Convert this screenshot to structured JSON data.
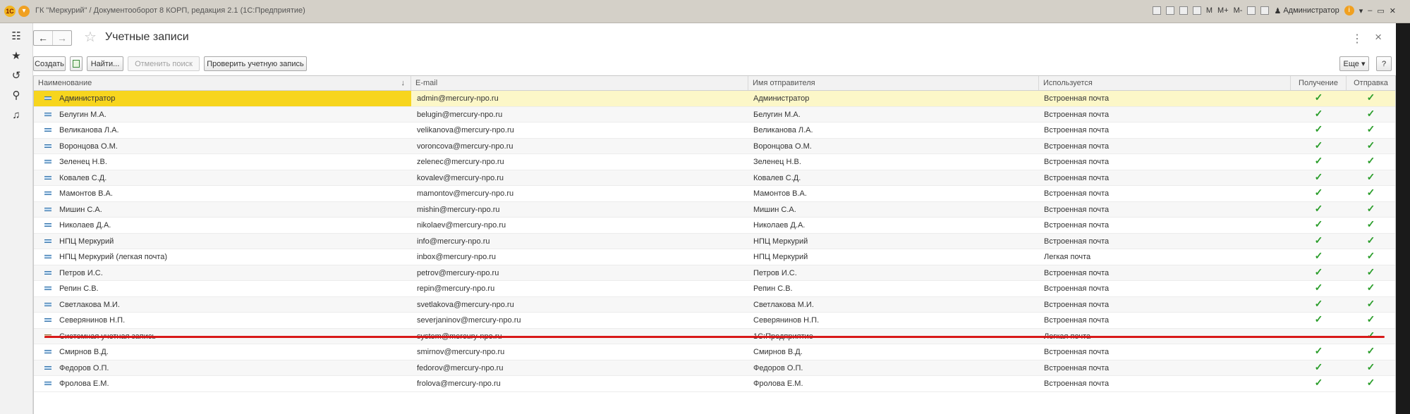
{
  "titlebar": {
    "logo": "1С",
    "title": "ГК \"Меркурий\" / Документооборот 8 КОРП, редакция 2.1 (1С:Предприятие)",
    "m": "M",
    "m_plus": "M+",
    "m_minus": "M-",
    "user": "Администратор",
    "info": "i"
  },
  "left_panel": {
    "icons": [
      "grid-menu-icon",
      "star-icon",
      "history-icon",
      "search-icon",
      "bell-icon"
    ]
  },
  "page": {
    "title": "Учетные записи",
    "more_dots": "⋮",
    "close": "×"
  },
  "toolbar": {
    "create": "Создать",
    "find": "Найти...",
    "cancel_search": "Отменить поиск",
    "check_account": "Проверить учетную запись",
    "more": "Еще ▾",
    "help": "?"
  },
  "table": {
    "columns": [
      "Наименование",
      "E-mail",
      "Имя отправителя",
      "Используется",
      "Получение",
      "Отправка"
    ],
    "sort_indicator": "↓",
    "check_mark": "✓",
    "rows": [
      {
        "name": "Администратор",
        "email": "admin@mercury-npo.ru",
        "sender": "Администратор",
        "used": "Встроенная почта",
        "receive": true,
        "send": true
      },
      {
        "name": "Белугин М.А.",
        "email": "belugin@mercury-npo.ru",
        "sender": "Белугин М.А.",
        "used": "Встроенная почта",
        "receive": true,
        "send": true
      },
      {
        "name": "Великанова Л.А.",
        "email": "velikanova@mercury-npo.ru",
        "sender": "Великанова Л.А.",
        "used": "Встроенная почта",
        "receive": true,
        "send": true
      },
      {
        "name": "Воронцова О.М.",
        "email": "voroncova@mercury-npo.ru",
        "sender": "Воронцова О.М.",
        "used": "Встроенная почта",
        "receive": true,
        "send": true
      },
      {
        "name": "Зеленец Н.В.",
        "email": "zelenec@mercury-npo.ru",
        "sender": "Зеленец Н.В.",
        "used": "Встроенная почта",
        "receive": true,
        "send": true
      },
      {
        "name": "Ковалев С.Д.",
        "email": "kovalev@mercury-npo.ru",
        "sender": "Ковалев С.Д.",
        "used": "Встроенная почта",
        "receive": true,
        "send": true
      },
      {
        "name": "Мамонтов В.А.",
        "email": "mamontov@mercury-npo.ru",
        "sender": "Мамонтов В.А.",
        "used": "Встроенная почта",
        "receive": true,
        "send": true
      },
      {
        "name": "Мишин С.А.",
        "email": "mishin@mercury-npo.ru",
        "sender": "Мишин С.А.",
        "used": "Встроенная почта",
        "receive": true,
        "send": true
      },
      {
        "name": "Николаев Д.А.",
        "email": "nikolaev@mercury-npo.ru",
        "sender": "Николаев Д.А.",
        "used": "Встроенная почта",
        "receive": true,
        "send": true
      },
      {
        "name": "НПЦ Меркурий",
        "email": "info@mercury-npo.ru",
        "sender": "НПЦ Меркурий",
        "used": "Встроенная почта",
        "receive": true,
        "send": true
      },
      {
        "name": "НПЦ Меркурий (легкая почта)",
        "email": "inbox@mercury-npo.ru",
        "sender": "НПЦ Меркурий",
        "used": "Легкая почта",
        "receive": true,
        "send": true
      },
      {
        "name": "Петров И.С.",
        "email": "petrov@mercury-npo.ru",
        "sender": "Петров И.С.",
        "used": "Встроенная почта",
        "receive": true,
        "send": true
      },
      {
        "name": "Репин С.В.",
        "email": "repin@mercury-npo.ru",
        "sender": "Репин С.В.",
        "used": "Встроенная почта",
        "receive": true,
        "send": true
      },
      {
        "name": "Светлакова М.И.",
        "email": "svetlakova@mercury-npo.ru",
        "sender": "Светлакова М.И.",
        "used": "Встроенная почта",
        "receive": true,
        "send": true
      },
      {
        "name": "Северянинов Н.П.",
        "email": "severjaninov@mercury-npo.ru",
        "sender": "Северянинов Н.П.",
        "used": "Встроенная почта",
        "receive": true,
        "send": true
      },
      {
        "name": "Системная учетная запись",
        "email": "system@mercury-npo.ru",
        "sender": "1С:Предприятие",
        "used": "Легкая почта",
        "receive": false,
        "send": true
      },
      {
        "name": "Смирнов В.Д.",
        "email": "smirnov@mercury-npo.ru",
        "sender": "Смирнов В.Д.",
        "used": "Встроенная почта",
        "receive": true,
        "send": true
      },
      {
        "name": "Федоров О.П.",
        "email": "fedorov@mercury-npo.ru",
        "sender": "Федоров О.П.",
        "used": "Встроенная почта",
        "receive": true,
        "send": true
      },
      {
        "name": "Фролова Е.М.",
        "email": "frolova@mercury-npo.ru",
        "sender": "Фролова Е.М.",
        "used": "Встроенная почта",
        "receive": true,
        "send": true
      }
    ]
  },
  "colors": {
    "selected_row": "#fcf7c8",
    "selected_cell": "#f7d51e",
    "check": "#2a9d2a",
    "annotation_line": "#d81919"
  }
}
